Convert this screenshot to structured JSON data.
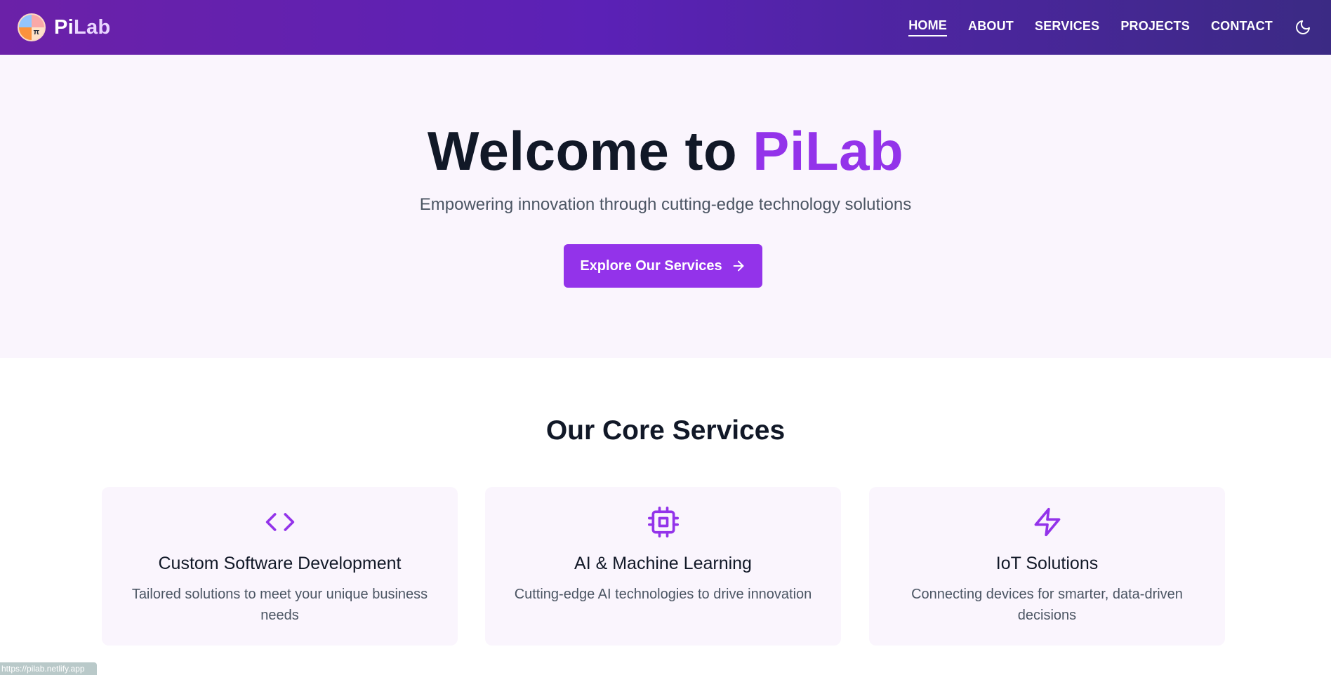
{
  "brand": {
    "name_pi": "Pi",
    "name_lab": "Lab",
    "logo_glyph": "π"
  },
  "nav": {
    "links": [
      {
        "label": "HOME",
        "active": true
      },
      {
        "label": "ABOUT",
        "active": false
      },
      {
        "label": "SERVICES",
        "active": false
      },
      {
        "label": "PROJECTS",
        "active": false
      },
      {
        "label": "CONTACT",
        "active": false
      }
    ],
    "theme_icon": "moon-icon"
  },
  "hero": {
    "title_prefix": "Welcome to ",
    "title_accent": "PiLab",
    "subtitle": "Empowering innovation through cutting-edge technology solutions",
    "cta_label": "Explore Our Services",
    "cta_icon": "arrow-right-icon"
  },
  "services": {
    "heading": "Our Core Services",
    "cards": [
      {
        "icon": "code-icon",
        "title": "Custom Software Development",
        "description": "Tailored solutions to meet your unique business needs"
      },
      {
        "icon": "cpu-icon",
        "title": "AI & Machine Learning",
        "description": "Cutting-edge AI technologies to drive innovation"
      },
      {
        "icon": "lightning-icon",
        "title": "IoT Solutions",
        "description": "Connecting devices for smarter, data-driven decisions"
      }
    ]
  },
  "status_bar": {
    "url": "https://pilab.netlify.app"
  },
  "colors": {
    "accent": "#9333ea",
    "nav_gradient_start": "#6b21a8",
    "nav_gradient_end": "#3b2a84",
    "hero_bg": "#faf5fd",
    "text_dark": "#111827",
    "text_muted": "#4b5563"
  }
}
